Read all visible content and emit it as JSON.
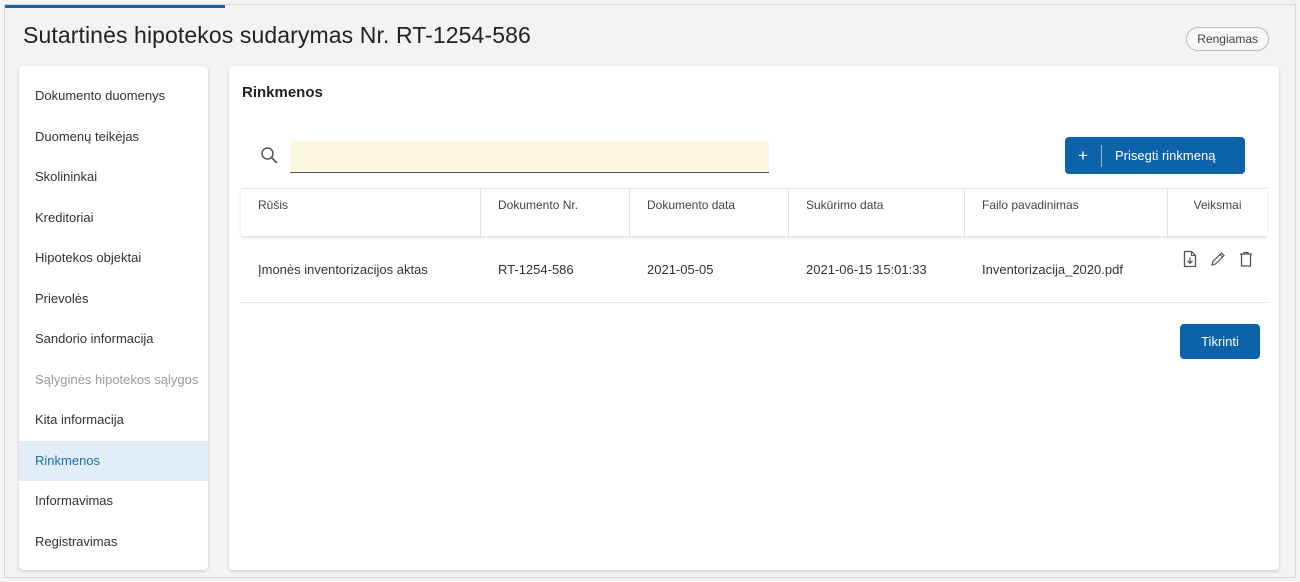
{
  "header": {
    "title": "Sutartinės hipotekos sudarymas Nr. RT-1254-586",
    "status": "Rengiamas"
  },
  "sidebar": {
    "items": [
      {
        "label": "Dokumento duomenys"
      },
      {
        "label": "Duomenų teikėjas"
      },
      {
        "label": "Skolininkai"
      },
      {
        "label": "Kreditoriai"
      },
      {
        "label": "Hipotekos objektai"
      },
      {
        "label": "Prievolės"
      },
      {
        "label": "Sandorio informacija"
      },
      {
        "label": "Sąlyginės hipotekos sąlygos"
      },
      {
        "label": "Kita informacija"
      },
      {
        "label": "Rinkmenos"
      },
      {
        "label": "Informavimas"
      },
      {
        "label": "Registravimas"
      }
    ],
    "active_index": 9,
    "disabled_index": 7
  },
  "main": {
    "section_title": "Rinkmenos",
    "search": {
      "value": "",
      "placeholder": ""
    },
    "attach_button": {
      "icon": "plus-icon",
      "label": "Prisegti rinkmeną"
    },
    "table": {
      "columns": [
        "Rūšis",
        "Dokumento Nr.",
        "Dokumento data",
        "Sukūrimo data",
        "Failo pavadinimas",
        "Veiksmai"
      ],
      "rows": [
        {
          "type": "Įmonės inventorizacijos aktas",
          "doc_no": "RT-1254-586",
          "doc_date": "2021-05-05",
          "created": "2021-06-15 15:01:33",
          "file_name": "Inventorizacija_2020.pdf",
          "actions": [
            "download-file-icon",
            "edit-pencil-icon",
            "delete-trash-icon"
          ]
        }
      ]
    },
    "check_button": {
      "label": "Tikrinti"
    }
  },
  "colors": {
    "accent": "#0d63aa",
    "active_bg": "#e2eef7",
    "search_bg": "#fdf8e2"
  }
}
